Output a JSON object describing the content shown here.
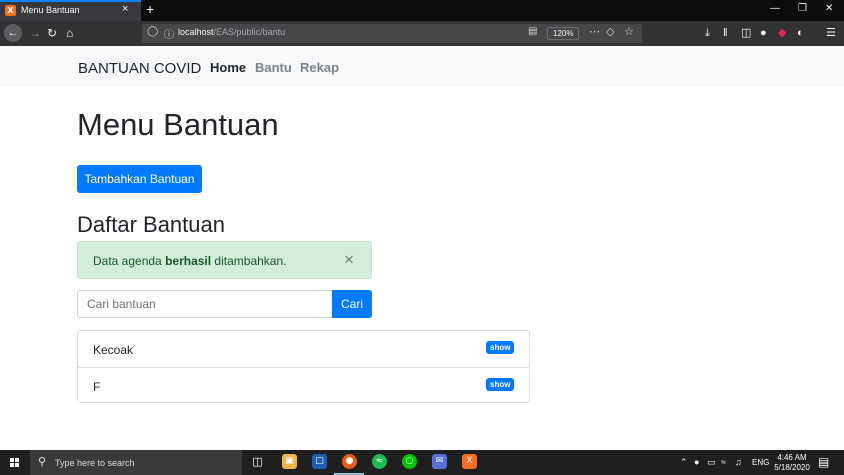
{
  "browser": {
    "tab_title": "Menu Bantuan",
    "tab_close": "×",
    "new_tab": "+",
    "url_host": "localhost",
    "url_path": "/EAS/public/bantu",
    "zoom": "120%",
    "win_minimize": "—",
    "win_restore": "❐",
    "win_close": "✕"
  },
  "site": {
    "brand": "BANTUAN COVID",
    "nav": [
      {
        "label": "Home",
        "active": true
      },
      {
        "label": "Bantu",
        "active": false
      },
      {
        "label": "Rekap",
        "active": false
      }
    ]
  },
  "main": {
    "title": "Menu Bantuan",
    "add_button": "Tambahkan Bantuan",
    "section_title": "Daftar Bantuan",
    "alert": {
      "text_before": "Data agenda ",
      "text_bold": "berhasil",
      "text_after": " ditambahkan.",
      "close": "×"
    },
    "search": {
      "placeholder": "Cari bantuan",
      "button": "Cari"
    },
    "items": [
      {
        "label": "Kecoak",
        "badge": "show"
      },
      {
        "label": "F",
        "badge": "show"
      }
    ]
  },
  "taskbar": {
    "search_placeholder": "Type here to search",
    "language": "ENG",
    "time": "4:46 AM",
    "date": "5/18/2020"
  },
  "colors": {
    "primary": "#007bff",
    "alert_bg": "#d4edda",
    "alert_text": "#155724"
  }
}
